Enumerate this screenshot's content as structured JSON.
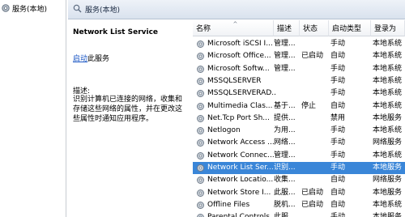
{
  "tree": {
    "label": "服务(本地)"
  },
  "header": {
    "label": "服务(本地)"
  },
  "description": {
    "title": "Network List Service",
    "action_link": "启动",
    "action_suffix": "此服务",
    "heading": "描述:",
    "body": "识别计算机已连接的网络，收集和存储这些网络的属性，并在更改这些属性时通知应用程序。"
  },
  "columns": {
    "name": "名称",
    "desc": "描述",
    "status": "状态",
    "startup": "启动类型",
    "logon": "登录为"
  },
  "rows": [
    {
      "name": "Microsoft iSCSI I...",
      "desc": "管理...",
      "status": "",
      "startup": "手动",
      "logon": "本地系统"
    },
    {
      "name": "Microsoft Office...",
      "desc": "管理...",
      "status": "已启动",
      "startup": "自动",
      "logon": "本地系统"
    },
    {
      "name": "Microsoft Softw...",
      "desc": "管理...",
      "status": "",
      "startup": "手动",
      "logon": "本地系统"
    },
    {
      "name": "MSSQLSERVER",
      "desc": "",
      "status": "",
      "startup": "手动",
      "logon": "本地系统"
    },
    {
      "name": "MSSQLSERVERAD...",
      "desc": "",
      "status": "",
      "startup": "手动",
      "logon": "本地系统"
    },
    {
      "name": "Multimedia Clas...",
      "desc": "基于...",
      "status": "停止",
      "startup": "自动",
      "logon": "本地系统"
    },
    {
      "name": "Net.Tcp Port Sh...",
      "desc": "提供...",
      "status": "",
      "startup": "禁用",
      "logon": "本地服务"
    },
    {
      "name": "Netlogon",
      "desc": "为用...",
      "status": "",
      "startup": "手动",
      "logon": "本地系统"
    },
    {
      "name": "Network Access ...",
      "desc": "网络...",
      "status": "",
      "startup": "手动",
      "logon": "网络服务"
    },
    {
      "name": "Network Connec...",
      "desc": "管理...",
      "status": "",
      "startup": "手动",
      "logon": "本地系统"
    },
    {
      "name": "Network List Ser...",
      "desc": "识别...",
      "status": "",
      "startup": "手动",
      "logon": "本地服务"
    },
    {
      "name": "Network Locatio...",
      "desc": "收集...",
      "status": "",
      "startup": "自动",
      "logon": "网络服务"
    },
    {
      "name": "Network Store I...",
      "desc": "此服...",
      "status": "已启动",
      "startup": "自动",
      "logon": "本地服务"
    },
    {
      "name": "Offline Files",
      "desc": "脱机...",
      "status": "已启动",
      "startup": "自动",
      "logon": "本地系统"
    },
    {
      "name": "Parental Controls",
      "desc": "此服...",
      "status": "",
      "startup": "手动",
      "logon": "本地服务"
    }
  ],
  "selected_row_name": "Network List Ser..."
}
